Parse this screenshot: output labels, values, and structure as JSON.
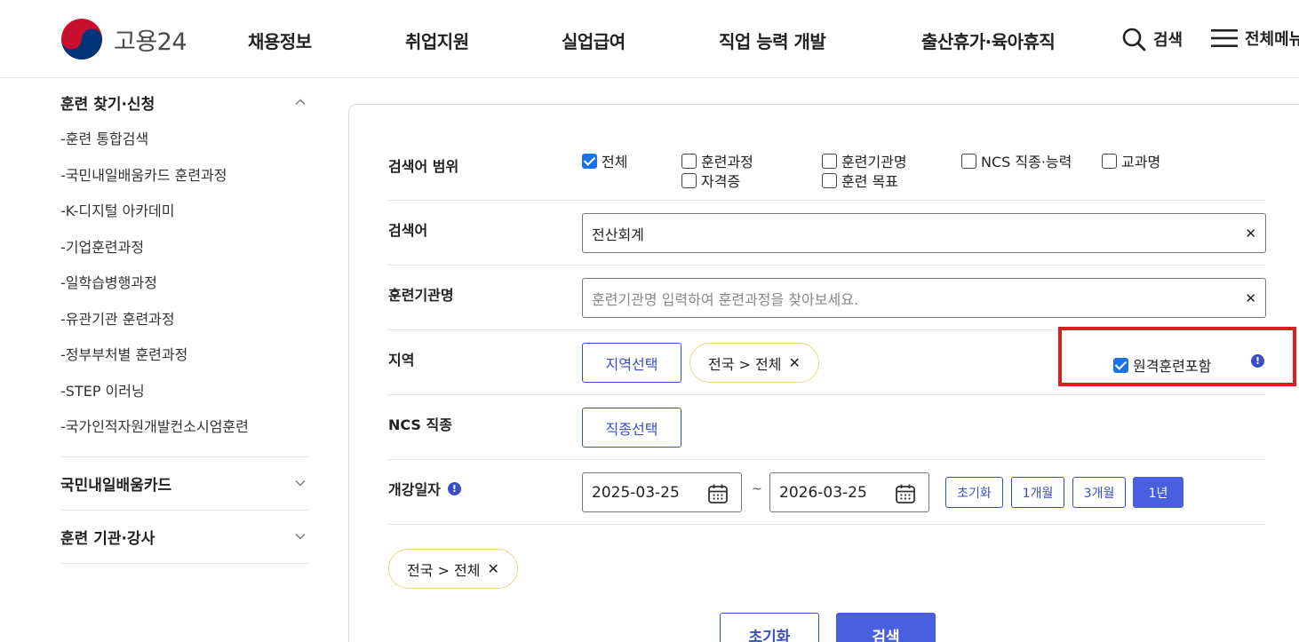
{
  "header": {
    "logo_text": "고용24",
    "menu": [
      "채용정보",
      "취업지원",
      "실업급여",
      "직업 능력 개발",
      "출산휴가·육아휴직"
    ],
    "search_label": "검색",
    "all_menu_label": "전체메뉴"
  },
  "sidebar": {
    "groups": [
      {
        "title": "훈련 찾기·신청",
        "expanded": true,
        "items": [
          "-훈련 통합검색",
          "-국민내일배움카드 훈련과정",
          "-K-디지털 아카데미",
          "-기업훈련과정",
          "-일학습병행과정",
          "-유관기관 훈련과정",
          "-정부부처별 훈련과정",
          "-STEP 이러닝",
          "-국가인적자원개발컨소시엄훈련"
        ]
      },
      {
        "title": "국민내일배움카드",
        "expanded": false
      },
      {
        "title": "훈련 기관·강사",
        "expanded": false
      }
    ]
  },
  "form": {
    "scope": {
      "label": "검색어 범위",
      "options": [
        {
          "label": "전체",
          "checked": true
        },
        {
          "label": "훈련과정",
          "checked": false
        },
        {
          "label": "훈련기관명",
          "checked": false
        },
        {
          "label": "NCS 직종·능력",
          "checked": false
        },
        {
          "label": "교과명",
          "checked": false
        },
        {
          "label": "자격증",
          "checked": false
        },
        {
          "label": "훈련 목표",
          "checked": false
        }
      ]
    },
    "keyword": {
      "label": "검색어",
      "value": "전산회계"
    },
    "institution": {
      "label": "훈련기관명",
      "placeholder": "훈련기관명 입력하여 훈련과정을 찾아보세요."
    },
    "region": {
      "label": "지역",
      "button": "지역선택",
      "chip": "전국 > 전체",
      "remote_label": "원격훈련포함",
      "remote_checked": true
    },
    "ncs": {
      "label": "NCS 직종",
      "button": "직종선택"
    },
    "date": {
      "label": "개강일자",
      "start": "2025-03-25",
      "end": "2026-03-25",
      "tilde": "~",
      "periods": [
        {
          "label": "초기화",
          "active": false
        },
        {
          "label": "1개월",
          "active": false
        },
        {
          "label": "3개월",
          "active": false
        },
        {
          "label": "1년",
          "active": true
        }
      ]
    },
    "summary_chip": "전국 > 전체",
    "reset_button": "초기화",
    "search_button": "검색"
  },
  "colors": {
    "primary": "#4a5fe0",
    "outline": "#3b4fc4",
    "checkbox": "#1a73e8",
    "highlight": "#d91f1f",
    "chip_border": "#e9d98c"
  }
}
